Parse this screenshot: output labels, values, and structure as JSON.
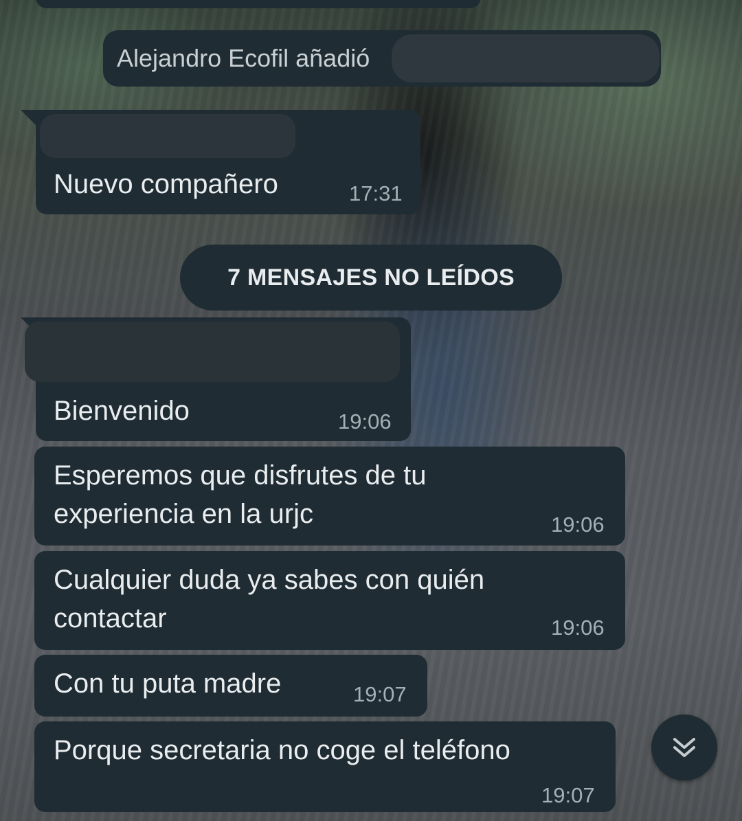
{
  "system_message": {
    "text": "Alejandro Ecofil añadió"
  },
  "unread_divider": {
    "label": "7 MENSAJES NO LEÍDOS"
  },
  "messages": [
    {
      "text": "Nuevo compañero",
      "time": "17:31"
    },
    {
      "text": "Bienvenido",
      "time": "19:06"
    },
    {
      "line1": "Esperemos que disfrutes de tu",
      "line2": "experiencia en la urjc",
      "time": "19:06"
    },
    {
      "line1": "Cualquier duda ya sabes con quién",
      "line2": "contactar",
      "time": "19:06"
    },
    {
      "text": "Con tu puta madre",
      "time": "19:07"
    },
    {
      "text": "Porque secretaria no coge el teléfono",
      "time": "19:07"
    }
  ],
  "icons": {
    "scroll_down": "double-chevron-down-icon"
  },
  "colors": {
    "bubble": "#1f2c33",
    "text": "#e9edef",
    "time": "#a5b0b6"
  }
}
